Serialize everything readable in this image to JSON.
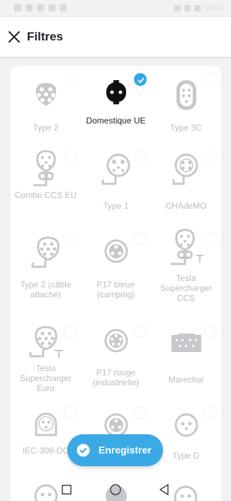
{
  "status_bar": {
    "time": "09:01"
  },
  "appbar": {
    "title": "Filtres"
  },
  "connectors": [
    {
      "label": "Type 2",
      "selected": false,
      "icon": "type2-socket-icon"
    },
    {
      "label": "Domestique UE",
      "selected": true,
      "icon": "schuko-plug-icon"
    },
    {
      "label": "Type 3C",
      "selected": false,
      "icon": "type3c-socket-icon"
    },
    {
      "label": "Combo CCS EU",
      "selected": false,
      "icon": "ccs-combo-eu-icon"
    },
    {
      "label": "Type 1",
      "selected": false,
      "icon": "type1-plug-icon"
    },
    {
      "label": "CHAdeMO",
      "selected": false,
      "icon": "chademo-plug-icon"
    },
    {
      "label": "Type 2 (câble attaché)",
      "selected": false,
      "icon": "type2-tethered-icon"
    },
    {
      "label": "P17 bleue (camping)",
      "selected": false,
      "icon": "p17-blue-icon"
    },
    {
      "label": "Tesla Supercharger CCS",
      "selected": false,
      "icon": "tesla-ccs-icon"
    },
    {
      "label": "Tesla Supercharger Euro",
      "selected": false,
      "icon": "tesla-euro-icon"
    },
    {
      "label": "P17 rouge (industrielle)",
      "selected": false,
      "icon": "p17-red-icon"
    },
    {
      "label": "Marechal",
      "selected": false,
      "icon": "marechal-socket-icon"
    },
    {
      "label": "IEC-309-DC",
      "selected": false,
      "icon": "iec-309-dc-icon"
    },
    {
      "label": "",
      "selected": false,
      "icon": "three-pin-socket-icon"
    },
    {
      "label": "Type D",
      "selected": false,
      "icon": "type-d-socket-icon"
    }
  ],
  "save_button": {
    "label": "Enregistrer"
  },
  "colors": {
    "accent": "#3aa9e6",
    "icon_gray": "#c6c8cc",
    "label_gray": "#b9bcc1",
    "text_dark": "#1f2328"
  }
}
